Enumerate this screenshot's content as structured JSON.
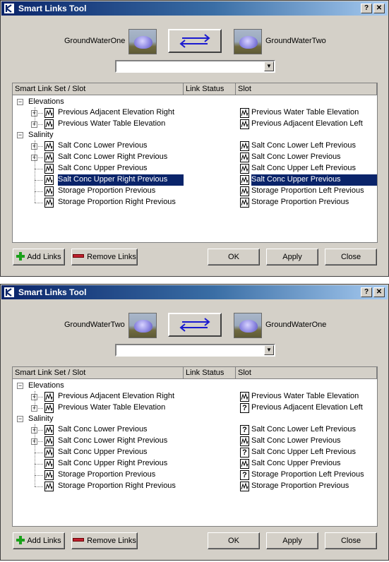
{
  "windows": [
    {
      "title": "Smart Links Tool",
      "source_object": "GroundWaterOne",
      "dest_object": "GroundWaterTwo",
      "dropdown_value": "",
      "columns": [
        "Smart Link Set / Slot",
        "Link Status",
        "Slot"
      ],
      "categories": [
        {
          "label": "Elevations",
          "rows": [
            {
              "name": "Previous Adjacent Elevation Right",
              "expandable": true,
              "slot": "Previous Water Table Elevation",
              "slot_icon": "graph",
              "selected": false
            },
            {
              "name": "Previous Water Table Elevation",
              "expandable": true,
              "slot": "Previous Adjacent Elevation Left",
              "slot_icon": "graph",
              "selected": false
            }
          ]
        },
        {
          "label": "Salinity",
          "rows": [
            {
              "name": "Salt Conc Lower Previous",
              "expandable": true,
              "slot": "Salt Conc Lower Left Previous",
              "slot_icon": "graph",
              "selected": false
            },
            {
              "name": "Salt Conc Lower Right Previous",
              "expandable": true,
              "slot": "Salt Conc Lower Previous",
              "slot_icon": "graph",
              "selected": false
            },
            {
              "name": "Salt Conc Upper Previous",
              "expandable": false,
              "slot": "Salt Conc Upper Left Previous",
              "slot_icon": "graph",
              "selected": false
            },
            {
              "name": "Salt Conc Upper Right Previous",
              "expandable": false,
              "slot": "Salt Conc Upper Previous",
              "slot_icon": "graph",
              "selected": true
            },
            {
              "name": "Storage Proportion Previous",
              "expandable": false,
              "slot": "Storage Proportion Left Previous",
              "slot_icon": "graph",
              "selected": false
            },
            {
              "name": "Storage Proportion Right Previous",
              "expandable": false,
              "slot": "Storage Proportion Previous",
              "slot_icon": "graph",
              "selected": false
            }
          ]
        }
      ],
      "buttons": {
        "add_links": "Add Links",
        "remove_links": "Remove Links",
        "ok": "OK",
        "apply": "Apply",
        "close": "Close"
      },
      "titlebar_buttons": {
        "help": "?",
        "close": "✕"
      }
    },
    {
      "title": "Smart Links Tool",
      "source_object": "GroundWaterTwo",
      "dest_object": "GroundWaterOne",
      "dropdown_value": "",
      "columns": [
        "Smart Link Set / Slot",
        "Link Status",
        "Slot"
      ],
      "categories": [
        {
          "label": "Elevations",
          "rows": [
            {
              "name": "Previous Adjacent Elevation Right",
              "expandable": true,
              "slot": "Previous Water Table Elevation",
              "slot_icon": "graph",
              "selected": false
            },
            {
              "name": "Previous Water Table Elevation",
              "expandable": true,
              "slot": "Previous Adjacent Elevation Left",
              "slot_icon": "unknown",
              "selected": false
            }
          ]
        },
        {
          "label": "Salinity",
          "rows": [
            {
              "name": "Salt Conc Lower Previous",
              "expandable": true,
              "slot": "Salt Conc Lower Left Previous",
              "slot_icon": "unknown",
              "selected": false
            },
            {
              "name": "Salt Conc Lower Right Previous",
              "expandable": true,
              "slot": "Salt Conc Lower Previous",
              "slot_icon": "graph",
              "selected": false
            },
            {
              "name": "Salt Conc Upper Previous",
              "expandable": false,
              "slot": "Salt Conc Upper Left Previous",
              "slot_icon": "unknown",
              "selected": false
            },
            {
              "name": "Salt Conc Upper Right Previous",
              "expandable": false,
              "slot": "Salt Conc Upper Previous",
              "slot_icon": "graph",
              "selected": false
            },
            {
              "name": "Storage Proportion Previous",
              "expandable": false,
              "slot": "Storage Proportion Left Previous",
              "slot_icon": "unknown",
              "selected": false
            },
            {
              "name": "Storage Proportion Right Previous",
              "expandable": false,
              "slot": "Storage Proportion Previous",
              "slot_icon": "graph",
              "selected": false
            }
          ]
        }
      ],
      "buttons": {
        "add_links": "Add Links",
        "remove_links": "Remove Links",
        "ok": "OK",
        "apply": "Apply",
        "close": "Close"
      },
      "titlebar_buttons": {
        "help": "?",
        "close": "✕"
      }
    }
  ]
}
